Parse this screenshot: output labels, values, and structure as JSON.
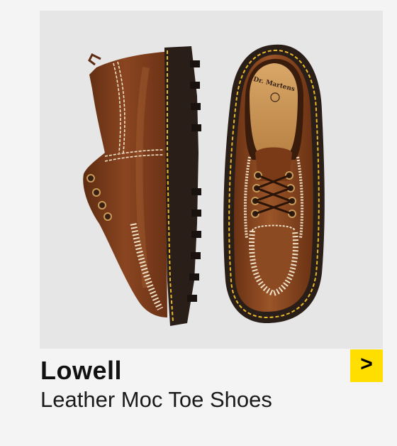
{
  "product": {
    "name": "Lowell",
    "description": "Leather Moc Toe Shoes",
    "image_alt_brand_mark": "Dr. Martens"
  },
  "actions": {
    "next_label": ">"
  },
  "colors": {
    "accent": "#ffde00",
    "image_background": "#e6e6e6",
    "page_background": "#f4f4f4",
    "leather": "#7a3e1c",
    "sole": "#2a1e18",
    "welt_stitch": "#e8b82a"
  }
}
